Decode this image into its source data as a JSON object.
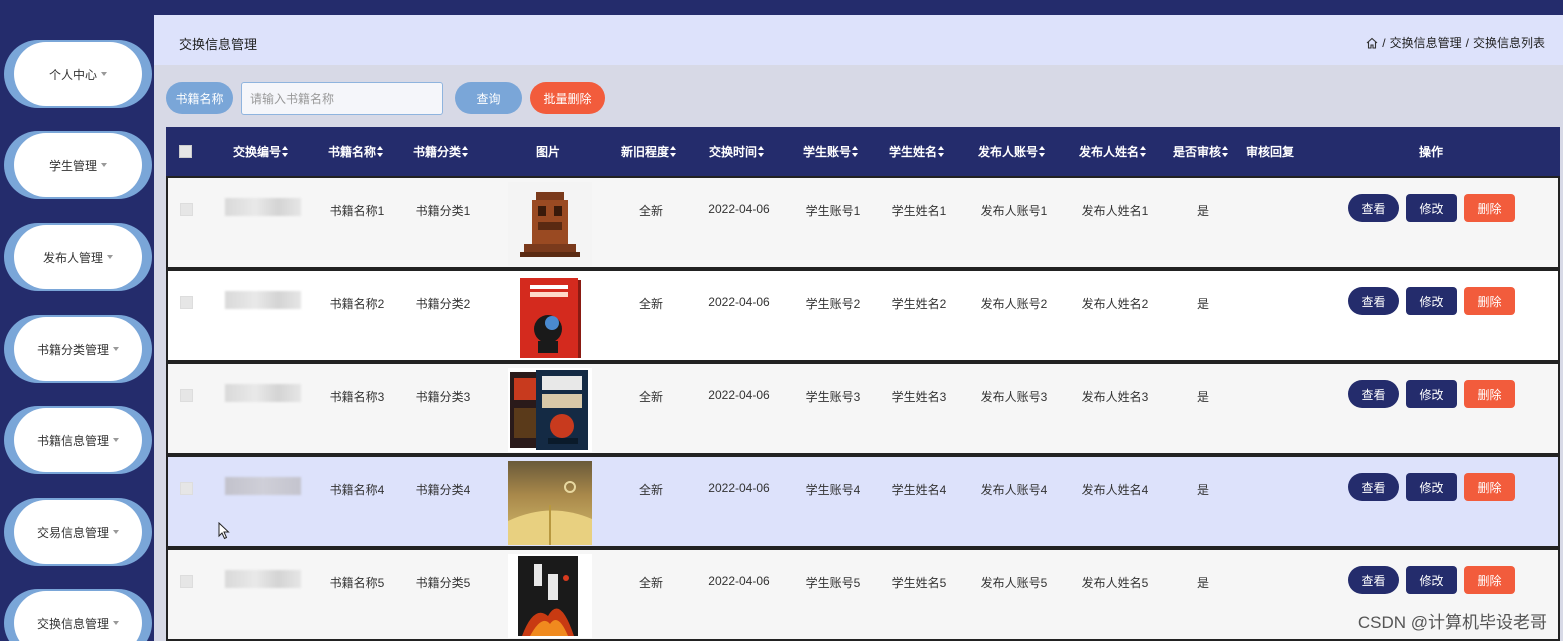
{
  "sidebar": {
    "items": [
      {
        "label": "个人中心"
      },
      {
        "label": "学生管理"
      },
      {
        "label": "发布人管理"
      },
      {
        "label": "书籍分类管理"
      },
      {
        "label": "书籍信息管理"
      },
      {
        "label": "交易信息管理"
      },
      {
        "label": "交换信息管理"
      }
    ]
  },
  "header": {
    "title": "交换信息管理",
    "breadcrumb": [
      "交换信息管理",
      "交换信息列表"
    ],
    "separator": "/"
  },
  "search": {
    "label": "书籍名称",
    "placeholder": "请输入书籍名称",
    "query_button": "查询",
    "batch_delete_button": "批量删除"
  },
  "table": {
    "columns": [
      "交换编号",
      "书籍名称",
      "书籍分类",
      "图片",
      "新旧程度",
      "交换时间",
      "学生账号",
      "学生姓名",
      "发布人账号",
      "发布人姓名",
      "是否审核",
      "审核回复",
      "操作"
    ],
    "rows": [
      {
        "book_name": "书籍名称1",
        "category": "书籍分类1",
        "condition": "全新",
        "time": "2022-04-06",
        "student_account": "学生账号1",
        "student_name": "学生姓名1",
        "publisher_account": "发布人账号1",
        "publisher_name": "发布人姓名1",
        "reviewed": "是",
        "reply": ""
      },
      {
        "book_name": "书籍名称2",
        "category": "书籍分类2",
        "condition": "全新",
        "time": "2022-04-06",
        "student_account": "学生账号2",
        "student_name": "学生姓名2",
        "publisher_account": "发布人账号2",
        "publisher_name": "发布人姓名2",
        "reviewed": "是",
        "reply": ""
      },
      {
        "book_name": "书籍名称3",
        "category": "书籍分类3",
        "condition": "全新",
        "time": "2022-04-06",
        "student_account": "学生账号3",
        "student_name": "学生姓名3",
        "publisher_account": "发布人账号3",
        "publisher_name": "发布人姓名3",
        "reviewed": "是",
        "reply": ""
      },
      {
        "book_name": "书籍名称4",
        "category": "书籍分类4",
        "condition": "全新",
        "time": "2022-04-06",
        "student_account": "学生账号4",
        "student_name": "学生姓名4",
        "publisher_account": "发布人账号4",
        "publisher_name": "发布人姓名4",
        "reviewed": "是",
        "reply": ""
      },
      {
        "book_name": "书籍名称5",
        "category": "书籍分类5",
        "condition": "全新",
        "time": "2022-04-06",
        "student_account": "学生账号5",
        "student_name": "学生姓名5",
        "publisher_account": "发布人账号5",
        "publisher_name": "发布人姓名5",
        "reviewed": "是",
        "reply": ""
      }
    ],
    "actions": {
      "view": "查看",
      "edit": "修改",
      "delete": "删除"
    }
  },
  "watermark": "CSDN @计算机毕设老哥",
  "colors": {
    "navy": "#242c6c",
    "accent_blue": "#7aa6d8",
    "danger": "#f25c3c",
    "header_bg": "#dde2fb"
  }
}
